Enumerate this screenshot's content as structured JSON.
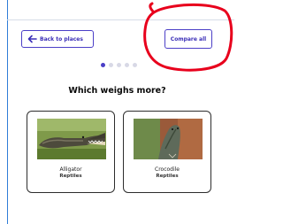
{
  "nav": {
    "back_label": "Back to places",
    "compare_label": "Compare all"
  },
  "pager": {
    "total": 5,
    "current": 1
  },
  "question": "Which weighs more?",
  "cards": [
    {
      "name": "Alligator",
      "category": "Reptiles",
      "image_icon": "alligator-photo"
    },
    {
      "name": "Crocodile",
      "category": "Reptiles",
      "image_icon": "crocodile-photo"
    }
  ],
  "colors": {
    "accent": "#4b3fc7",
    "annotation": "#e8001c",
    "frame": "#2f7dd8"
  }
}
